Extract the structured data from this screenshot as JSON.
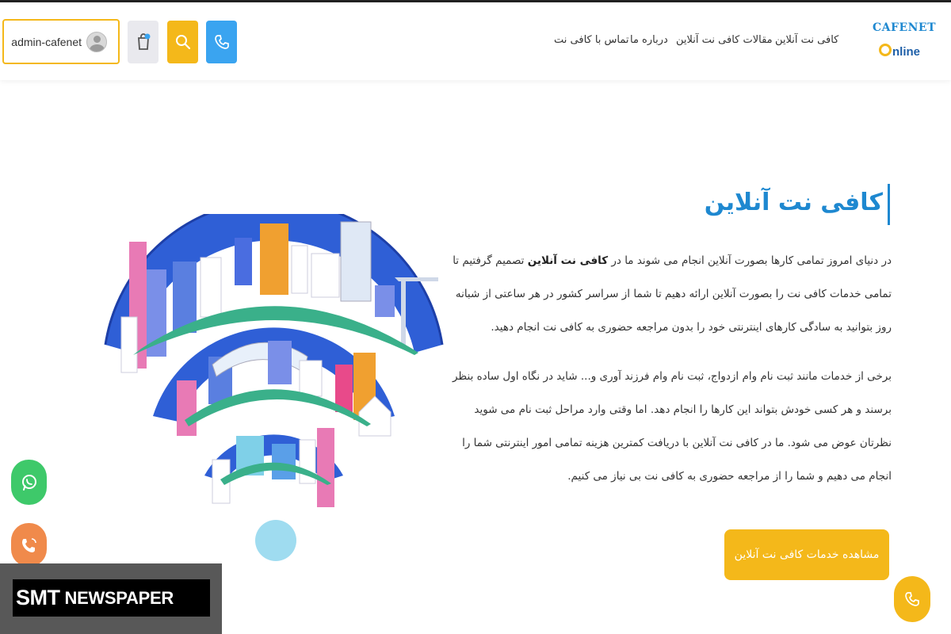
{
  "header": {
    "user_label": "admin-cafenet",
    "nav": [
      "کافی نت آنلاین",
      "مقالات کافی نت آنلاین",
      "درباره ما",
      "تماس با کافی نت"
    ],
    "logo_line1": "CAFENET",
    "logo_line2": "nline"
  },
  "hero": {
    "title": "کافی نت آنلاین",
    "p1_before": "در دنیای امروز تمامی کارها بصورت آنلاین انجام می شوند ما در ",
    "p1_bold": "کافی نت آنلاین",
    "p1_after": " تصمیم گرفتیم تا تمامی خدمات کافی نت را بصورت آنلاین ارائه دهیم تا شما از سراسر کشور در هر ساعتی از شبانه روز بتوانید به سادگی کارهای اینترنتی خود را بدون مراجعه حضوری به کافی نت انجام دهید.",
    "p2": "برخی از خدمات مانند ثبت نام وام ازدواج، ثبت نام وام فرزند آوری و... شاید در نگاه اول ساده بنظر برسند و هر کسی خودش بتواند این کارها را انجام دهد. اما وقتی وارد مراحل ثبت نام می شوید نظرتان عوض می شود. ما در کافی نت آنلاین با دریافت کمترین هزینه تمامی امور اینترنتی شما را انجام می دهیم و شما را از مراجعه حضوری به کافی نت بی نیاز می کنیم.",
    "cta": "مشاهده خدمات کافی نت آنلاین"
  },
  "watermark": {
    "part1": "SMT",
    "part2": "NEWSPAPER"
  },
  "icons": {
    "cart": "cart-icon",
    "search": "search-icon",
    "phone": "phone-icon",
    "whatsapp": "whatsapp-icon",
    "call": "call-icon"
  },
  "colors": {
    "accent_yellow": "#f4b81a",
    "accent_blue": "#3aa4f0",
    "title_blue": "#1e88d0",
    "whatsapp_green": "#3ec96a",
    "call_orange": "#f08a4b"
  }
}
